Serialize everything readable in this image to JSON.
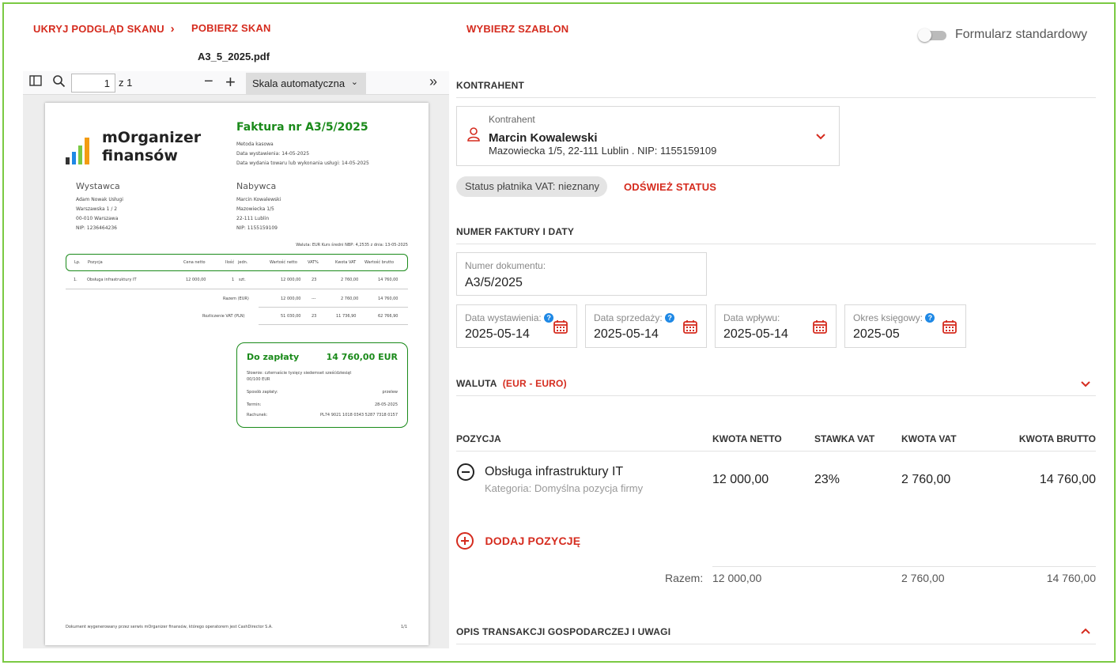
{
  "top": {
    "hide_scan": "UKRYJ PODGLĄD SKANU",
    "download_scan": "POBIERZ SKAN",
    "choose_template": "WYBIERZ SZABLON",
    "toggle_label": "Formularz standardowy",
    "filename": "A3_5_2025.pdf"
  },
  "viewer": {
    "page_current": "1",
    "page_total": "z 1",
    "scale": "Skala automatyczna"
  },
  "invoice": {
    "logo_line1": "mOrganizer",
    "logo_line2": "finansów",
    "title": "Faktura nr A3/5/2025",
    "meta": [
      "Metoda kasowa",
      "Data wystawienia: 14-05-2025",
      "Data wydania towaru lub wykonania usługi: 14-05-2025"
    ],
    "seller_label": "Wystawca",
    "seller": [
      "Adam Nowak Usługi",
      "Warszawska 1 / 2",
      "00-010 Warszawa",
      "NIP: 1236464236"
    ],
    "buyer_label": "Nabywca",
    "buyer": [
      "Marcin Kowalewski",
      "Mazowiecka 1/5",
      "22-111 Lublin",
      "NIP: 1155159109"
    ],
    "currency_line": "Waluta: EUR   Kurs średni NBP: 4,2535   z dnia: 13-05-2025",
    "table_headers": [
      "Lp.",
      "Pozycja",
      "Cena netto",
      "Ilość",
      "jedn.",
      "Wartość netto",
      "VAT%",
      "Kwota VAT",
      "Wartość brutto"
    ],
    "row": [
      "1.",
      "Obsługa infrastruktury IT",
      "12 000,00",
      "1",
      "szt.",
      "12 000,00",
      "23",
      "2 760,00",
      "14 760,00"
    ],
    "sum_label": "Razem (EUR)",
    "sum": [
      "12 000,00",
      "---",
      "2 760,00",
      "14 760,00"
    ],
    "pln_label": "Rozliczenie VAT (PLN)",
    "pln": [
      "51 030,00",
      "23",
      "11 736,90",
      "62 766,90"
    ],
    "pay_label": "Do zapłaty",
    "pay_amount": "14 760,00 EUR",
    "words": "Słownie: czternaście tysięcy siedemset sześćdziesiąt 00/100 EUR",
    "method_label": "Sposób zapłaty:",
    "method": "przelew",
    "due_label": "Termin:",
    "due": "28-05-2025",
    "account_label": "Rachunek:",
    "account": "PL74 9021 1018 0343 5287 7318 0157",
    "footer": "Dokument wygenerowany przez serwis mOrganizer finansów, którego operatorem jest CashDirector S.A.",
    "page_no": "1/1"
  },
  "form": {
    "contractor_section": "KONTRAHENT",
    "contractor_label": "Kontrahent",
    "contractor_name": "Marcin Kowalewski",
    "contractor_address": "Mazowiecka 1/5, 22-111 Lublin . NIP: 1155159109",
    "vat_status": "Status płatnika VAT: nieznany",
    "refresh_status": "ODŚWIEŻ STATUS",
    "number_section": "NUMER FAKTURY I DATY",
    "doc_number_label": "Numer dokumentu:",
    "doc_number": "A3/5/2025",
    "issue_label": "Data wystawienia:",
    "issue_date": "2025-05-14",
    "sale_label": "Data sprzedaży:",
    "sale_date": "2025-05-14",
    "receipt_label": "Data wpływu:",
    "receipt_date": "2025-05-14",
    "period_label": "Okres księgowy:",
    "period": "2025-05",
    "currency_section": "WALUTA",
    "currency_value": "(EUR - EURO)",
    "positions": {
      "headers": [
        "POZYCJA",
        "KWOTA NETTO",
        "STAWKA VAT",
        "KWOTA VAT",
        "KWOTA BRUTTO"
      ],
      "item_name": "Obsługa infrastruktury IT",
      "item_category": "Kategoria: Domyślna pozycja firmy",
      "net": "12 000,00",
      "rate": "23%",
      "vat": "2 760,00",
      "gross": "14 760,00",
      "add_label": "DODAJ POZYCJĘ",
      "total_label": "Razem:",
      "total_net": "12 000,00",
      "total_vat": "2 760,00",
      "total_gross": "14 760,00"
    },
    "description_section": "OPIS TRANSAKCJI GOSPODARCZEJ I UWAGI"
  },
  "colors": {
    "accent": "#d52b1e",
    "green": "#1a8a1a",
    "border": "#7ac943",
    "info": "#1e88e5"
  }
}
